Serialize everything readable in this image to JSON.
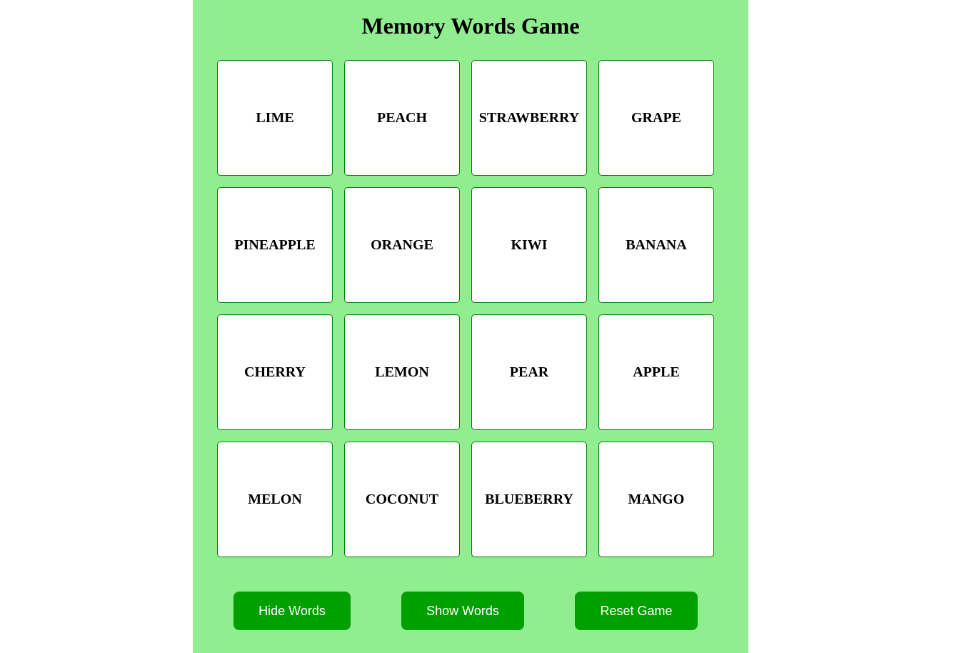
{
  "title": "Memory Words Game",
  "cards": [
    "LIME",
    "PEACH",
    "STRAWBERRY",
    "GRAPE",
    "PINEAPPLE",
    "ORANGE",
    "KIWI",
    "BANANA",
    "CHERRY",
    "LEMON",
    "PEAR",
    "APPLE",
    "MELON",
    "COCONUT",
    "BLUEBERRY",
    "MANGO"
  ],
  "buttons": {
    "hide": "Hide Words",
    "show": "Show Words",
    "reset": "Reset Game"
  },
  "colors": {
    "background": "#90ee90",
    "button": "#00a000",
    "card_border": "#008000"
  }
}
